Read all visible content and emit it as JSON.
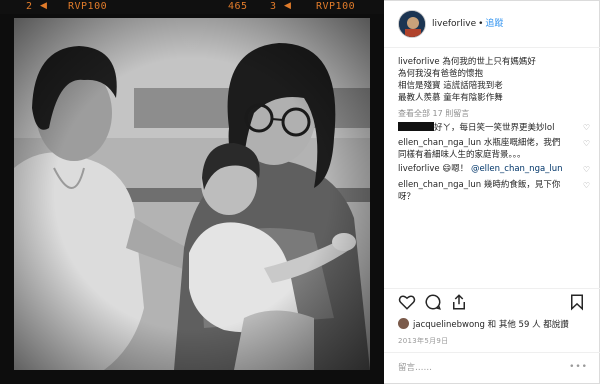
{
  "film": {
    "left_num": "2",
    "left_label": "RVP100",
    "mid_num": "465",
    "right_num": "3",
    "right_label": "RVP100"
  },
  "post": {
    "username": "liveforlive",
    "follow_label": "追蹤",
    "caption_lines": [
      "為何我的世上只有媽媽好",
      "為何我沒有爸爸的懷抱",
      "相信是殘寶 這謊話陪我到老",
      "最教人羨慕 童年有陰影作舞"
    ],
    "view_all_label": "查看全部 17 則留言",
    "comments": [
      {
        "user": "",
        "text": "好ㄚ，每日笑一笑世界更美妙lol"
      },
      {
        "user": "ellen_chan_nga_lun",
        "text": "水瓶座嘅細佬，我們同樣有着細味人生的家庭背景。。。"
      },
      {
        "user": "liveforlive",
        "emoji": "😄",
        "text_pre": "嗯！",
        "mention": "@ellen_chan_nga_lun"
      },
      {
        "user": "ellen_chan_nga_lun",
        "text": "幾時約食飯，見下你呀？"
      }
    ],
    "likes": {
      "user": "jacquelinebwong",
      "text": "和 其他 59 人 都說讚"
    },
    "date": "2013年5月9日",
    "comment_placeholder": "留言……",
    "more_label": "•••"
  }
}
